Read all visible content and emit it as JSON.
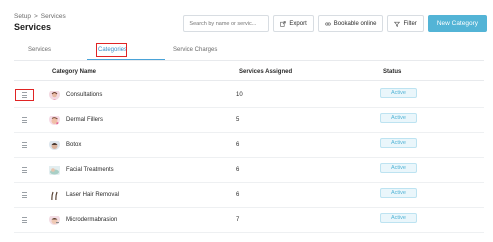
{
  "breadcrumb": {
    "parent": "Setup",
    "separator": ">",
    "current": "Services"
  },
  "page_title": "Services",
  "toolbar": {
    "search_placeholder": "Search by name or servic...",
    "export_label": "Export",
    "bookable_label": "Bookable online",
    "filter_label": "Filter",
    "new_category_label": "New Category"
  },
  "tabs": [
    {
      "label": "Services",
      "active": false
    },
    {
      "label": "Categories",
      "active": true
    },
    {
      "label": "Service Charges",
      "active": false
    }
  ],
  "table": {
    "headers": {
      "name": "Category Name",
      "services": "Services Assigned",
      "status": "Status"
    },
    "rows": [
      {
        "name": "Consultations",
        "services": "10",
        "status": "Active",
        "icon": "consultation-icon"
      },
      {
        "name": "Dermal Fillers",
        "services": "5",
        "status": "Active",
        "icon": "dermal-fillers-icon"
      },
      {
        "name": "Botox",
        "services": "6",
        "status": "Active",
        "icon": "botox-icon"
      },
      {
        "name": "Facial Treatments",
        "services": "6",
        "status": "Active",
        "icon": "facial-treatment-icon"
      },
      {
        "name": "Laser Hair Removal",
        "services": "6",
        "status": "Active",
        "icon": "laser-hair-removal-icon"
      },
      {
        "name": "Microdermabrasion",
        "services": "7",
        "status": "Active",
        "icon": "microdermabrasion-icon"
      }
    ]
  },
  "colors": {
    "accent": "#53b4d6",
    "highlight": "#e02424",
    "badge_bg": "#eaf6fb"
  }
}
